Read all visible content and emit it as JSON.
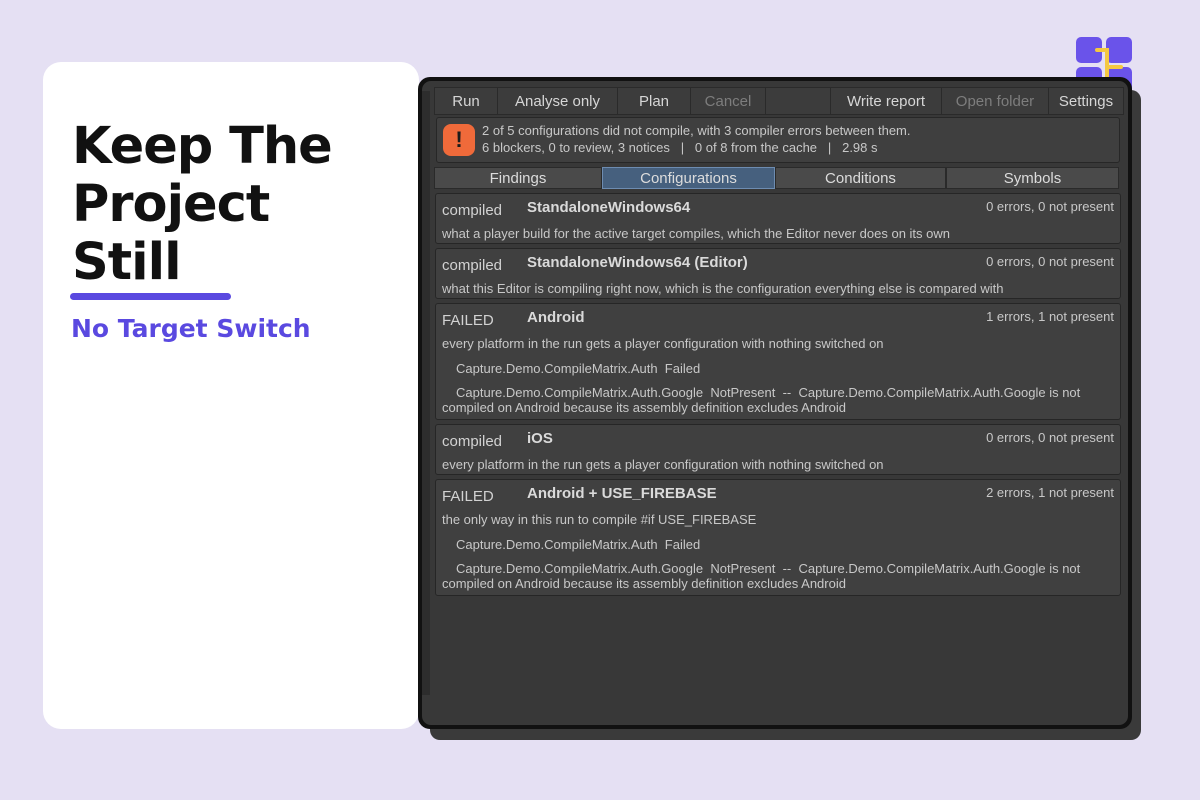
{
  "hero": {
    "title_lines": [
      "Keep The",
      "Project",
      "Still"
    ],
    "subtitle": "No Target Switch"
  },
  "colors": {
    "accent": "#5a49e0",
    "warning": "#f06a3a",
    "active_tab": "#46607e"
  },
  "toolbar": {
    "run": "Run",
    "analyse_only": "Analyse only",
    "plan": "Plan",
    "cancel": "Cancel",
    "write_report": "Write report",
    "open_folder": "Open folder",
    "settings": "Settings"
  },
  "status": {
    "icon": "warning-icon",
    "line1": "2 of 5 configurations did not compile, with 3 compiler errors between them.",
    "line2": "6 blockers, 0 to review, 3 notices   |   0 of 8 from the cache   |   2.98 s"
  },
  "tabs": [
    "Findings",
    "Configurations",
    "Conditions",
    "Symbols"
  ],
  "active_tab": "Configurations",
  "configurations": [
    {
      "state": "compiled",
      "name": "StandaloneWindows64",
      "count": "0 errors, 0 not present",
      "description": "what a player build for the active target compiles, which the Editor never does on its own",
      "details": []
    },
    {
      "state": "compiled",
      "name": "StandaloneWindows64 (Editor)",
      "count": "0 errors, 0 not present",
      "description": "what this Editor is compiling right now, which is the configuration everything else is compared with",
      "details": []
    },
    {
      "state": "FAILED",
      "name": "Android",
      "count": "1 errors, 1 not present",
      "description": "every platform in the run gets a player configuration with nothing switched on",
      "details": [
        "Capture.Demo.CompileMatrix.Auth  Failed",
        "Capture.Demo.CompileMatrix.Auth.Google  NotPresent  --  Capture.Demo.CompileMatrix.Auth.Google is not compiled on Android because its assembly definition excludes Android"
      ]
    },
    {
      "state": "compiled",
      "name": "iOS",
      "count": "0 errors, 0 not present",
      "description": "every platform in the run gets a player configuration with nothing switched on",
      "details": []
    },
    {
      "state": "FAILED",
      "name": "Android + USE_FIREBASE",
      "count": "2 errors, 1 not present",
      "description": "the only way in this run to compile #if USE_FIREBASE",
      "details": [
        "Capture.Demo.CompileMatrix.Auth  Failed",
        "Capture.Demo.CompileMatrix.Auth.Google  NotPresent  --  Capture.Demo.CompileMatrix.Auth.Google is not compiled on Android because its assembly definition excludes Android"
      ]
    }
  ]
}
